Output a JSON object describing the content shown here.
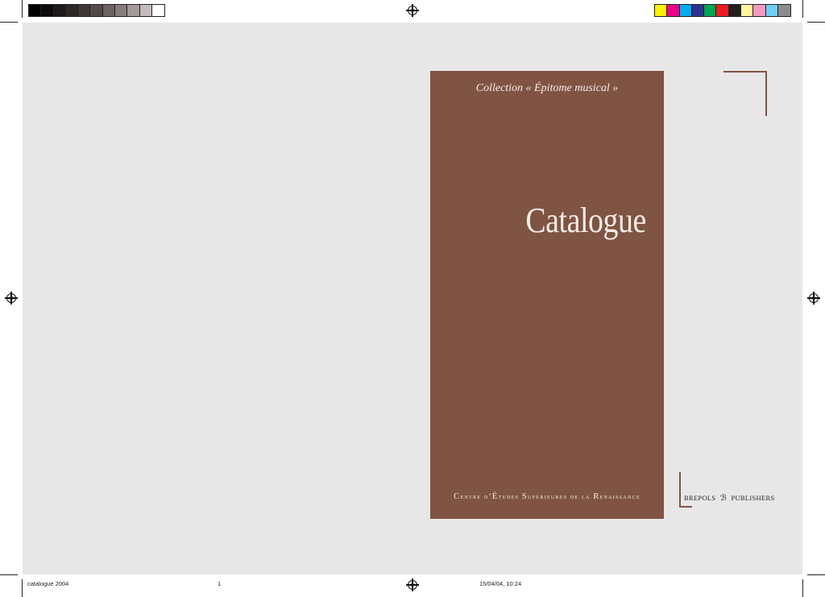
{
  "cover": {
    "collection": "Collection « Épitome musical »",
    "title": "Catalogue",
    "institute": {
      "c": "C",
      "entre": "entre d’",
      "e": "É",
      "tudes": "tudes ",
      "s": "S",
      "uperieures": "upérieures de la ",
      "r": "R",
      "enaissance": "enaissance"
    }
  },
  "publisher": {
    "left": "brepols",
    "logo": "ℬ",
    "right": "publishers"
  },
  "slug": {
    "file": "catalogue 2004",
    "page": "1",
    "datetime": "15/04/04, 10:24"
  },
  "colors": {
    "cover_brown": "#805442",
    "gray_bar": [
      "#000000",
      "#0d0d0d",
      "#1f1a1a",
      "#2e2828",
      "#403838",
      "#544a4a",
      "#6c6262",
      "#877d7d",
      "#a49b9b",
      "#c3bcbc",
      "#ffffff"
    ],
    "color_bar": [
      "#fff200",
      "#ec008c",
      "#00aeef",
      "#2e3192",
      "#00a651",
      "#ed1c24",
      "#231f20",
      "#fff799",
      "#f49ac1",
      "#6dcff6",
      "#8c8c8c"
    ]
  }
}
